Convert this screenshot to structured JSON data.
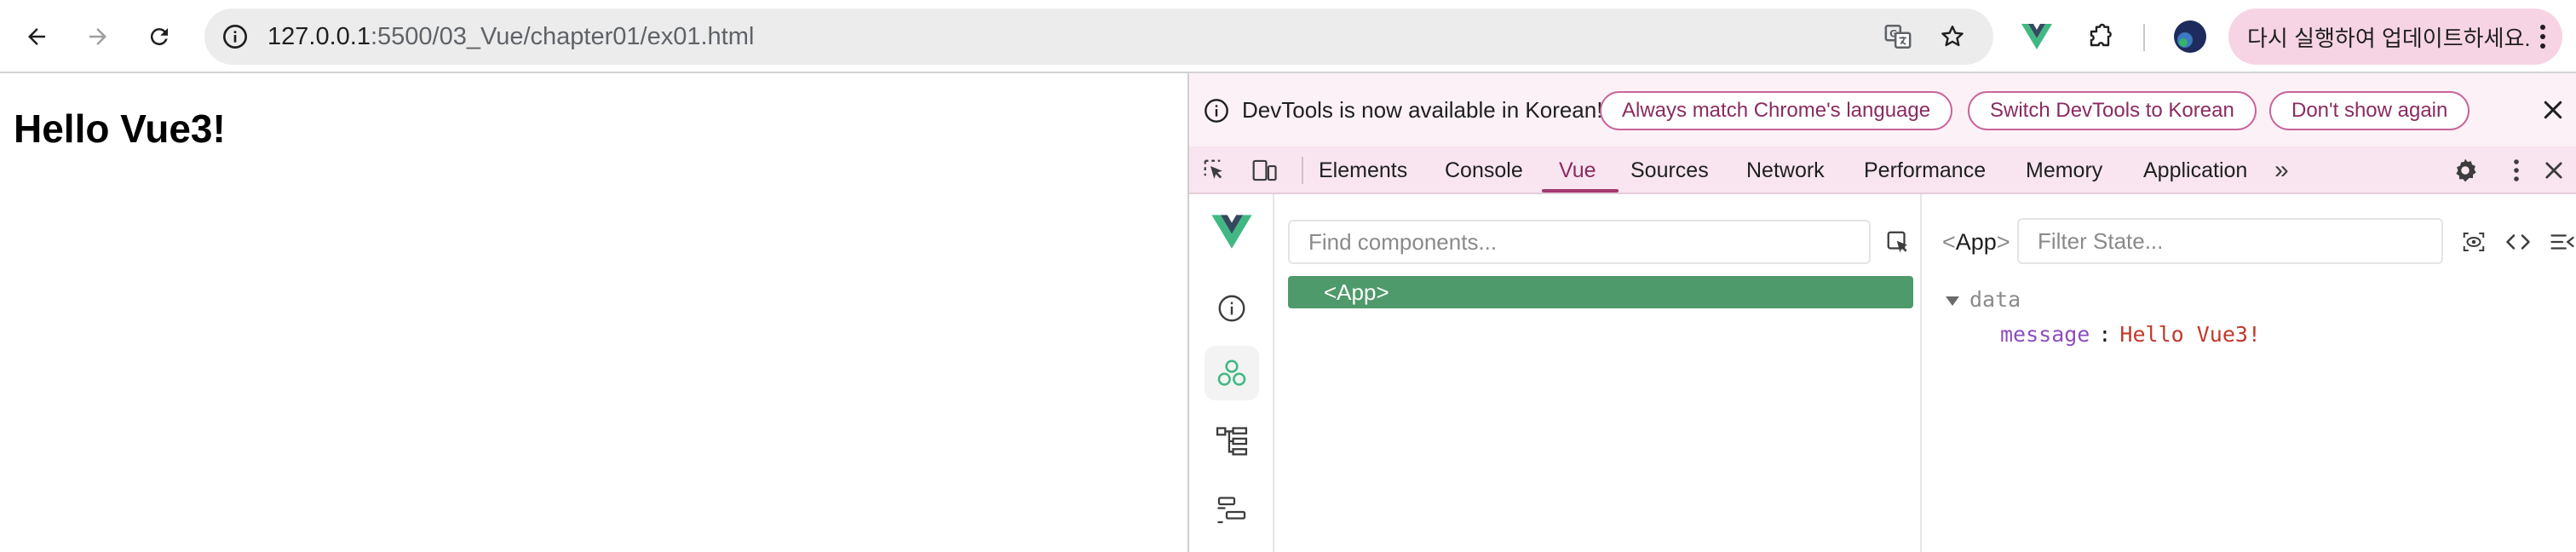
{
  "browser": {
    "url_host": "127.0.0.1",
    "url_rest": ":5500/03_Vue/chapter01/ex01.html",
    "update_button": "다시 실행하여 업데이트하세요."
  },
  "page": {
    "heading": "Hello Vue3!"
  },
  "devtools": {
    "infobar": {
      "text": "DevTools is now available in Korean!",
      "buttons": [
        "Always match Chrome's language",
        "Switch DevTools to Korean",
        "Don't show again"
      ]
    },
    "tabs": [
      "Elements",
      "Console",
      "Vue",
      "Sources",
      "Network",
      "Performance",
      "Memory",
      "Application"
    ],
    "active_tab": "Vue",
    "more_tabs": "»",
    "vue": {
      "find_placeholder": "Find components...",
      "tree": [
        "<App>"
      ],
      "selected_component": "App",
      "filter_placeholder": "Filter State...",
      "section": "data",
      "props": [
        {
          "key": "message",
          "value": "Hello Vue3!"
        }
      ]
    }
  },
  "colors": {
    "vue_green": "#4f9a6a",
    "accent_pink": "#a3396f",
    "update_bg": "#f7d4e3",
    "string_value": "#c0392b",
    "prop_key": "#8d4dbf"
  }
}
